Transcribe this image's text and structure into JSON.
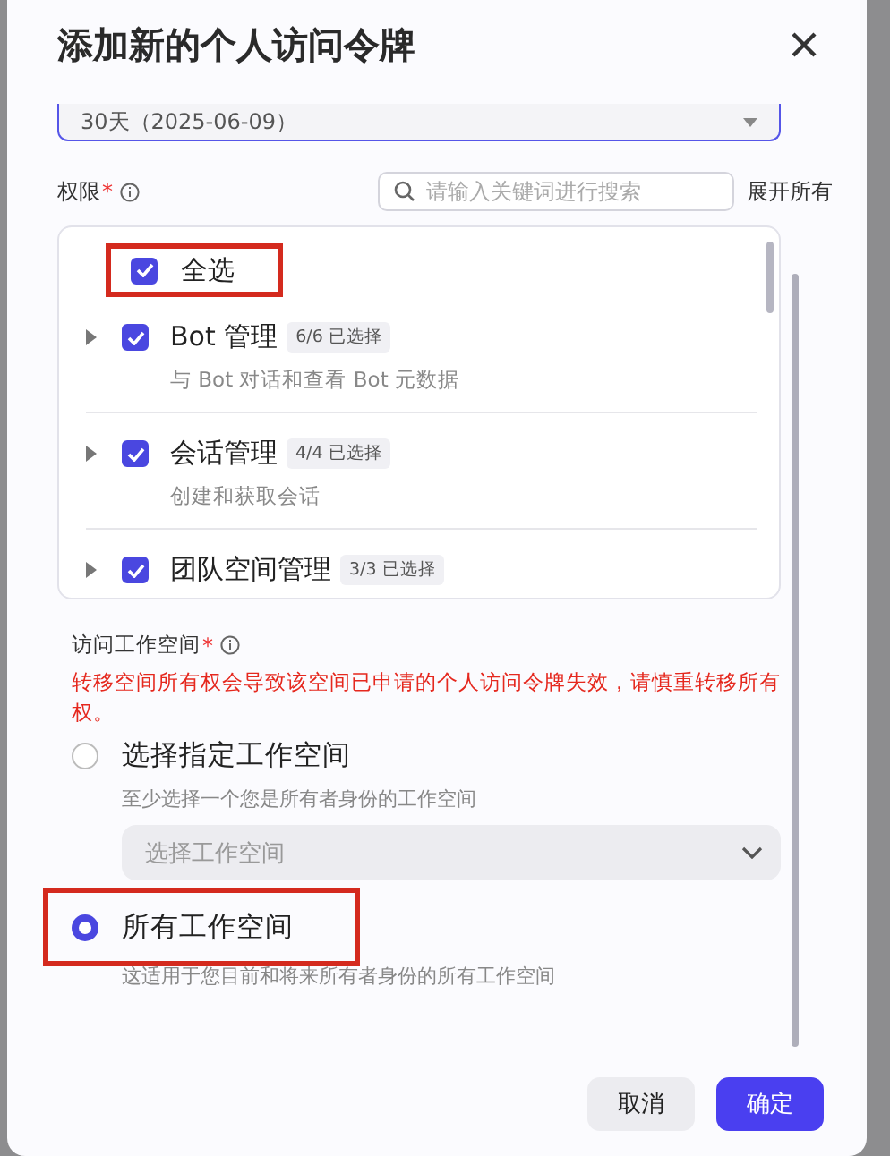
{
  "dialog": {
    "title": "添加新的个人访问令牌",
    "expiry_select": {
      "value": "30天（2025-06-09）"
    }
  },
  "permissions": {
    "label": "权限",
    "required_mark": "*",
    "search": {
      "placeholder": "请输入关键词进行搜索"
    },
    "expand_all": "展开所有",
    "select_all": {
      "label": "全选",
      "checked": true,
      "highlighted": true
    },
    "items": [
      {
        "name": "Bot 管理",
        "count": "6/6 已选择",
        "description": "与 Bot 对话和查看 Bot 元数据",
        "checked": true,
        "expanded": false
      },
      {
        "name": "会话管理",
        "count": "4/4 已选择",
        "description": "创建和获取会话",
        "checked": true,
        "expanded": false
      },
      {
        "name": "团队空间管理",
        "count": "3/3 已选择",
        "checked": true,
        "expanded": false
      }
    ]
  },
  "workspace": {
    "label": "访问工作空间",
    "required_mark": "*",
    "warning": "转移空间所有权会导致该空间已申请的个人访问令牌失效，请慎重转移所有权。",
    "options": [
      {
        "label": "选择指定工作空间",
        "hint": "至少选择一个您是所有者身份的工作空间",
        "selected": false,
        "highlighted": false,
        "select": {
          "placeholder": "选择工作空间"
        }
      },
      {
        "label": "所有工作空间",
        "hint": "这适用于您目前和将来所有者身份的所有工作空间",
        "selected": true,
        "highlighted": true
      }
    ]
  },
  "buttons": [
    {
      "label": "取消",
      "kind": "secondary"
    },
    {
      "label": "确定",
      "kind": "primary"
    }
  ]
}
